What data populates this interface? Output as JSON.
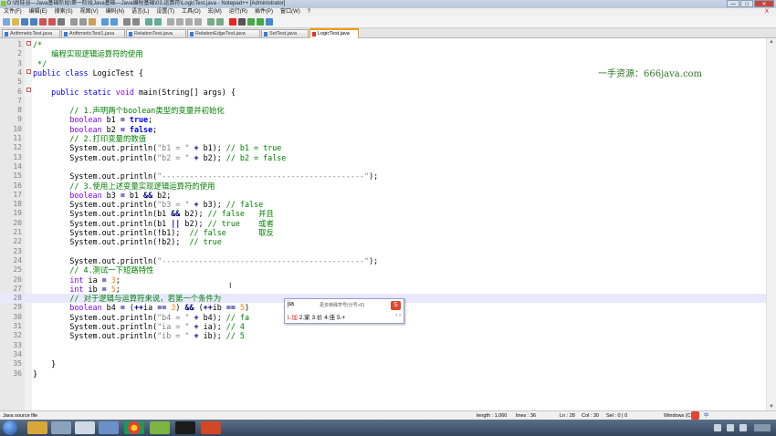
{
  "window": {
    "title": "D:\\尚硅谷—Java基础阶段\\第一阶段Java基础—Java编程基础\\03.运算符\\LogicTest.java - Notepad++ [Administrator]",
    "minimize": "—",
    "maximize": "□",
    "close": "✕"
  },
  "menu": [
    "文件(F)",
    "编辑(E)",
    "搜索(S)",
    "视图(V)",
    "编码(N)",
    "语言(L)",
    "设置(T)",
    "工具(O)",
    "宏(M)",
    "运行(R)",
    "插件(P)",
    "窗口(W)",
    "?"
  ],
  "menu_close": "X",
  "tabs": [
    {
      "label": "ArithmeticTest.java"
    },
    {
      "label": "ArithmeticTest1.java"
    },
    {
      "label": "RelationTest.java"
    },
    {
      "label": "RelationEdgeTest.java"
    },
    {
      "label": "SetTest.java"
    },
    {
      "label": "LogicTest.java",
      "active": true
    }
  ],
  "watermark": "一手资源：666java.com",
  "editor": {
    "lines": [
      {
        "n": "1",
        "parts": [
          [
            "cm",
            "/*"
          ]
        ]
      },
      {
        "n": "2",
        "parts": [
          [
            "cm",
            "    编程实现逻辑运算符的使用"
          ]
        ]
      },
      {
        "n": "3",
        "parts": [
          [
            "cm",
            " */"
          ]
        ]
      },
      {
        "n": "4",
        "parts": [
          [
            "kw",
            "public"
          ],
          [
            "",
            " "
          ],
          [
            "kw",
            "class"
          ],
          [
            "",
            " LogicTest {"
          ]
        ]
      },
      {
        "n": "5",
        "parts": []
      },
      {
        "n": "6",
        "parts": [
          [
            "",
            "    "
          ],
          [
            "kw",
            "public"
          ],
          [
            "",
            " "
          ],
          [
            "kw",
            "static"
          ],
          [
            "",
            " "
          ],
          [
            "ty",
            "void"
          ],
          [
            "",
            " main(String[] args) {"
          ]
        ]
      },
      {
        "n": "7",
        "parts": []
      },
      {
        "n": "8",
        "parts": [
          [
            "",
            "        "
          ],
          [
            "cm",
            "// 1.声明两个boolean类型的变量并初始化"
          ]
        ]
      },
      {
        "n": "9",
        "parts": [
          [
            "",
            "        "
          ],
          [
            "ty",
            "boolean"
          ],
          [
            "",
            " b1 "
          ],
          [
            "op",
            "="
          ],
          [
            "",
            " "
          ],
          [
            "kb",
            "true"
          ],
          [
            "",
            ";"
          ]
        ]
      },
      {
        "n": "10",
        "parts": [
          [
            "",
            "        "
          ],
          [
            "ty",
            "boolean"
          ],
          [
            "",
            " b2 "
          ],
          [
            "op",
            "="
          ],
          [
            "",
            " "
          ],
          [
            "kb",
            "false"
          ],
          [
            "",
            ";"
          ]
        ]
      },
      {
        "n": "11",
        "parts": [
          [
            "",
            "        "
          ],
          [
            "cm",
            "// 2.打印变量的数值"
          ]
        ]
      },
      {
        "n": "12",
        "parts": [
          [
            "",
            "        System.out.println("
          ],
          [
            "str",
            "\"b1 = \""
          ],
          [
            "",
            " "
          ],
          [
            "op",
            "+"
          ],
          [
            "",
            " b1); "
          ],
          [
            "cm",
            "// b1 = true"
          ]
        ]
      },
      {
        "n": "13",
        "parts": [
          [
            "",
            "        System.out.println("
          ],
          [
            "str",
            "\"b2 = \""
          ],
          [
            "",
            " "
          ],
          [
            "op",
            "+"
          ],
          [
            "",
            " b2); "
          ],
          [
            "cm",
            "// b2 = false"
          ]
        ]
      },
      {
        "n": "14",
        "parts": []
      },
      {
        "n": "15",
        "parts": [
          [
            "",
            "        System.out.println("
          ],
          [
            "str",
            "\"--------------------------------------------\""
          ],
          [
            "",
            ");"
          ]
        ]
      },
      {
        "n": "16",
        "parts": [
          [
            "",
            "        "
          ],
          [
            "cm",
            "// 3.使用上述变量实现逻辑运算符的使用"
          ]
        ]
      },
      {
        "n": "17",
        "parts": [
          [
            "",
            "        "
          ],
          [
            "ty",
            "boolean"
          ],
          [
            "",
            " b3 "
          ],
          [
            "op",
            "="
          ],
          [
            "",
            " b1 "
          ],
          [
            "op",
            "&&"
          ],
          [
            "",
            " b2;"
          ]
        ]
      },
      {
        "n": "18",
        "parts": [
          [
            "",
            "        System.out.println("
          ],
          [
            "str",
            "\"b3 = \""
          ],
          [
            "",
            " "
          ],
          [
            "op",
            "+"
          ],
          [
            "",
            " b3); "
          ],
          [
            "cm",
            "// false"
          ]
        ]
      },
      {
        "n": "19",
        "parts": [
          [
            "",
            "        System.out.println(b1 "
          ],
          [
            "op",
            "&&"
          ],
          [
            "",
            " b2); "
          ],
          [
            "cm",
            "// false   并且"
          ]
        ]
      },
      {
        "n": "20",
        "parts": [
          [
            "",
            "        System.out.println(b1 "
          ],
          [
            "op",
            "||"
          ],
          [
            "",
            " b2); "
          ],
          [
            "cm",
            "// true    或者"
          ]
        ]
      },
      {
        "n": "21",
        "parts": [
          [
            "",
            "        System.out.println("
          ],
          [
            "op",
            "!"
          ],
          [
            "",
            "b1);  "
          ],
          [
            "cm",
            "// false       取反"
          ]
        ]
      },
      {
        "n": "22",
        "parts": [
          [
            "",
            "        System.out.println("
          ],
          [
            "op",
            "!"
          ],
          [
            "",
            "b2);  "
          ],
          [
            "cm",
            "// true"
          ]
        ]
      },
      {
        "n": "23",
        "parts": []
      },
      {
        "n": "24",
        "parts": [
          [
            "",
            "        System.out.println("
          ],
          [
            "str",
            "\"--------------------------------------------\""
          ],
          [
            "",
            ");"
          ]
        ]
      },
      {
        "n": "25",
        "parts": [
          [
            "",
            "        "
          ],
          [
            "cm",
            "// 4.测试一下短路特性"
          ]
        ]
      },
      {
        "n": "26",
        "parts": [
          [
            "",
            "        "
          ],
          [
            "ty",
            "int"
          ],
          [
            "",
            " ia "
          ],
          [
            "op",
            "="
          ],
          [
            "",
            " "
          ],
          [
            "num",
            "3"
          ],
          [
            "",
            ";"
          ]
        ]
      },
      {
        "n": "27",
        "parts": [
          [
            "",
            "        "
          ],
          [
            "ty",
            "int"
          ],
          [
            "",
            " ib "
          ],
          [
            "op",
            "="
          ],
          [
            "",
            " "
          ],
          [
            "num",
            "5"
          ],
          [
            "",
            ";"
          ]
        ]
      },
      {
        "n": "28",
        "parts": [
          [
            "",
            "        "
          ],
          [
            "cm",
            "// 对于逻辑与运算符来说，若第一个条件为"
          ]
        ],
        "current": true
      },
      {
        "n": "29",
        "parts": [
          [
            "",
            "        "
          ],
          [
            "ty",
            "boolean"
          ],
          [
            "",
            " b4 "
          ],
          [
            "op",
            "="
          ],
          [
            "",
            " ("
          ],
          [
            "op",
            "++"
          ],
          [
            "",
            "ia "
          ],
          [
            "op",
            "=="
          ],
          [
            "",
            " "
          ],
          [
            "num",
            "3"
          ],
          [
            "",
            ") "
          ],
          [
            "op",
            "&&"
          ],
          [
            "",
            " ("
          ],
          [
            "op",
            "++"
          ],
          [
            "",
            "ib "
          ],
          [
            "op",
            "=="
          ],
          [
            "",
            " "
          ],
          [
            "num",
            "5"
          ],
          [
            "",
            ")"
          ]
        ]
      },
      {
        "n": "30",
        "parts": [
          [
            "",
            "        System.out.println("
          ],
          [
            "str",
            "\"b4 = \""
          ],
          [
            "",
            " "
          ],
          [
            "op",
            "+"
          ],
          [
            "",
            " b4); "
          ],
          [
            "cm",
            "// fa"
          ]
        ]
      },
      {
        "n": "31",
        "parts": [
          [
            "",
            "        System.out.println("
          ],
          [
            "str",
            "\"ia = \""
          ],
          [
            "",
            " "
          ],
          [
            "op",
            "+"
          ],
          [
            "",
            " ia); "
          ],
          [
            "cm",
            "// 4"
          ]
        ]
      },
      {
        "n": "32",
        "parts": [
          [
            "",
            "        System.out.println("
          ],
          [
            "str",
            "\"ib = \""
          ],
          [
            "",
            " "
          ],
          [
            "op",
            "+"
          ],
          [
            "",
            " ib); "
          ],
          [
            "cm",
            "// 5"
          ]
        ]
      },
      {
        "n": "33",
        "parts": []
      },
      {
        "n": "34",
        "parts": []
      },
      {
        "n": "35",
        "parts": [
          [
            "",
            "    }"
          ]
        ]
      },
      {
        "n": "36",
        "parts": [
          [
            "",
            "}"
          ]
        ]
      }
    ]
  },
  "ime": {
    "composition": "jia",
    "hint": "更多特殊符号(分号+F)",
    "candidates": [
      "1.加",
      "2.家",
      "3.价",
      "4.佳",
      "5.+"
    ],
    "logo": "S",
    "prev": "‹",
    "next": "›"
  },
  "status": {
    "filetype": "Java source file",
    "length": "length : 1,060",
    "lines": "lines : 36",
    "ln": "Ln : 28",
    "col": "Col : 30",
    "sel": "Sel : 0 | 0",
    "eol": "Windows (C",
    "ime_indicator": "中"
  },
  "colors": {
    "accent_tab": "#f39c12",
    "comment": "#008000",
    "keyword": "#0000ff",
    "type": "#8000ff",
    "number": "#ff8000"
  }
}
